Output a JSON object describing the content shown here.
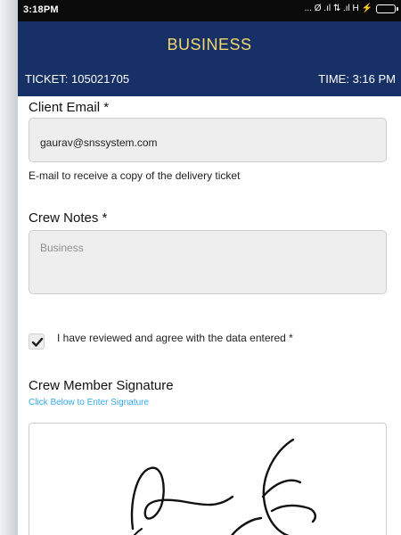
{
  "status_bar": {
    "time": "3:18PM",
    "indicators": "... Ø .ıl ⇅ .ıl H ⚡"
  },
  "header": {
    "title": "BUSINESS",
    "ticket_label": "TICKET: 105021705",
    "time_label": "TIME: 3:16 PM"
  },
  "form": {
    "client_email_label": "Client Email *",
    "client_email_value": "gaurav@snssystem.com",
    "client_email_hint": "E-mail to receive a copy of the delivery ticket",
    "crew_notes_label": "Crew Notes *",
    "crew_notes_placeholder": "Business",
    "agreement_text": "I have reviewed and agree with the data entered *",
    "agreement_checked": true,
    "signature_label": "Crew Member Signature",
    "signature_instruction": "Click Below to Enter Signature"
  },
  "colors": {
    "header_bg": "#173066",
    "title_text": "#f5d76e",
    "link_text": "#36a8e8",
    "field_bg": "#eeeeee"
  },
  "icons": {
    "checkmark": "checkmark-icon",
    "battery": "battery-icon"
  }
}
